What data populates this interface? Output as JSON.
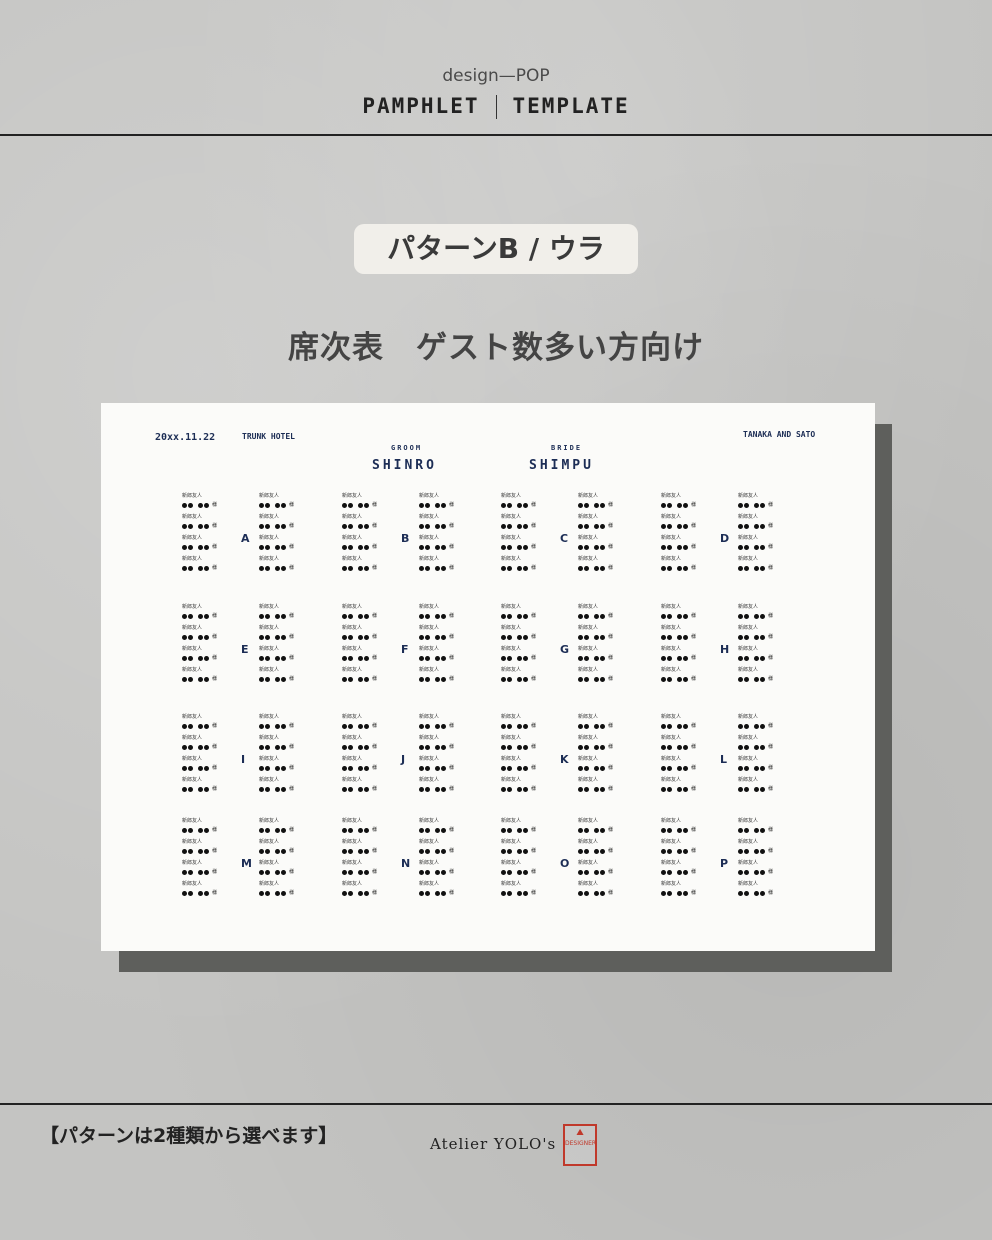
{
  "header": {
    "brand": "design—POP",
    "left": "PAMPHLET",
    "right": "TEMPLATE"
  },
  "pill": "パターンB / ウラ",
  "subtitle": "席次表　ゲスト数多い方向け",
  "sheet": {
    "date": "20xx.11.22",
    "hotel": "TRUNK HOTEL",
    "couple": "TANAKA AND SATO",
    "groom_role": "GROOM",
    "groom_name": "SHINRO",
    "bride_role": "BRIDE",
    "bride_name": "SHIMPU",
    "guest_label": "新郎友人",
    "honorific": "様",
    "tables": [
      "A",
      "B",
      "C",
      "D",
      "E",
      "F",
      "G",
      "H",
      "I",
      "J",
      "K",
      "L",
      "M",
      "N",
      "O",
      "P"
    ]
  },
  "footer": {
    "note": "【パターンは2種類から選べます】",
    "atelier": "Atelier  YOLO's",
    "stamp_lines": [
      "DESIGNER"
    ]
  }
}
